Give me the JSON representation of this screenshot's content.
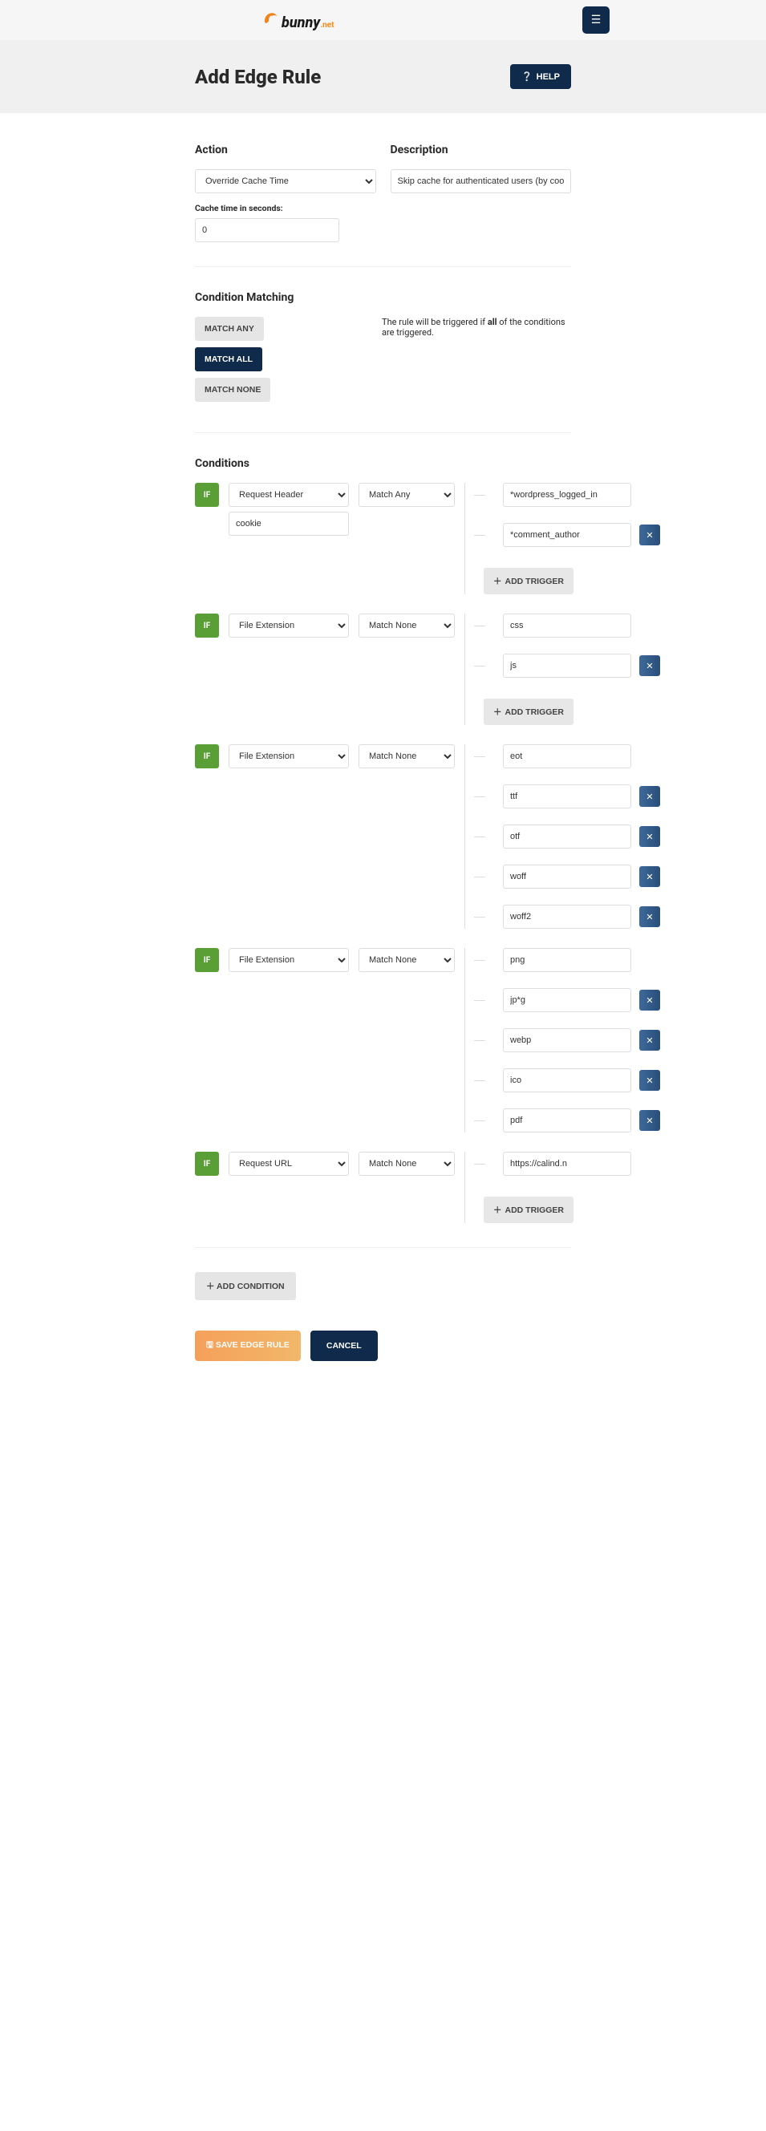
{
  "brand": {
    "name": "bunny",
    "suffix": ".net"
  },
  "header": {
    "title": "Add Edge Rule",
    "help": "HELP"
  },
  "action": {
    "title": "Action",
    "selected": "Override Cache Time",
    "sublabel": "Cache time in seconds:",
    "cache_seconds": "0"
  },
  "description": {
    "title": "Description",
    "value": "Skip cache for authenticated users (by cookie)"
  },
  "condition_matching": {
    "title": "Condition Matching",
    "match_any": "MATCH ANY",
    "match_all": "MATCH ALL",
    "match_none": "MATCH NONE",
    "desc_pre": "The rule will be triggered if ",
    "desc_bold": "all",
    "desc_post": " of the conditions are triggered."
  },
  "conditions_title": "Conditions",
  "if_label": "IF",
  "add_trigger_label": "ADD TRIGGER",
  "add_condition_label": "ADD CONDITION",
  "footer": {
    "save": "SAVE EDGE RULE",
    "cancel": "CANCEL"
  },
  "conditions": [
    {
      "type": "Request Header",
      "match": "Match Any",
      "param": "cookie",
      "triggers": [
        "*wordpress_logged_in",
        "*comment_author"
      ]
    },
    {
      "type": "File Extension",
      "match": "Match None",
      "triggers": [
        "css",
        "js"
      ]
    },
    {
      "type": "File Extension",
      "match": "Match None",
      "triggers": [
        "eot",
        "ttf",
        "otf",
        "woff",
        "woff2"
      ]
    },
    {
      "type": "File Extension",
      "match": "Match None",
      "triggers": [
        "png",
        "jp*g",
        "webp",
        "ico",
        "pdf"
      ]
    },
    {
      "type": "Request URL",
      "match": "Match None",
      "triggers": [
        "https://calind.n"
      ]
    }
  ]
}
